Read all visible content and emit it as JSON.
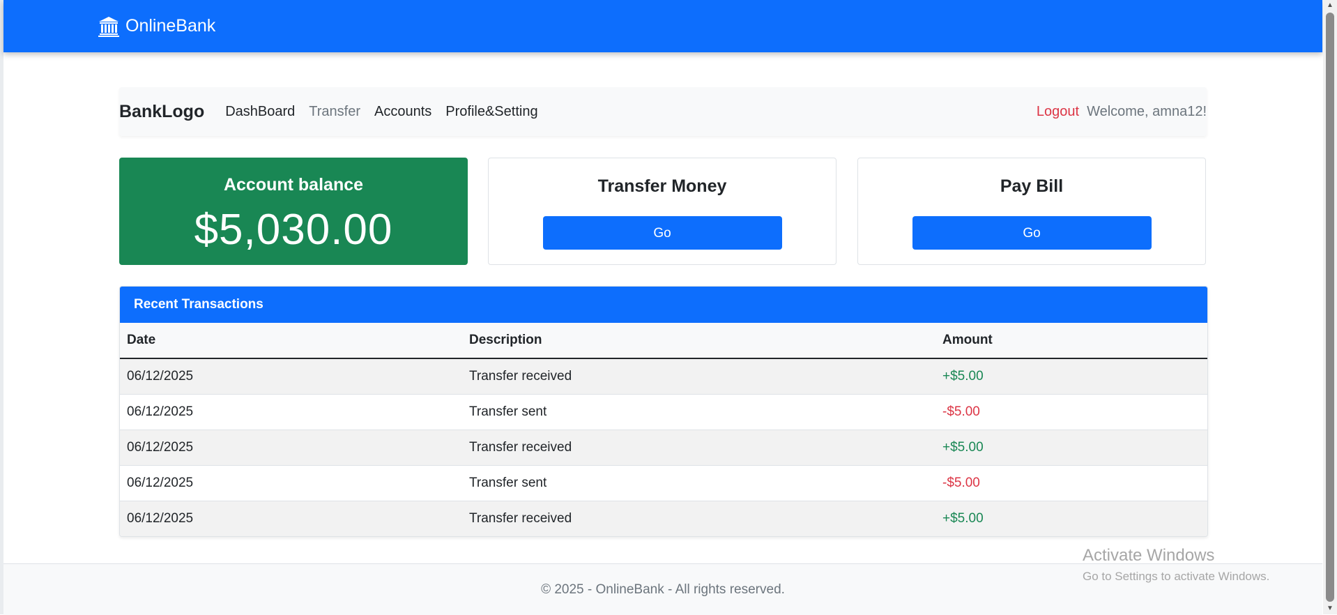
{
  "app": {
    "brand_name": "OnlineBank",
    "brand_icon": "bank-icon"
  },
  "nav": {
    "logo": "BankLogo",
    "links": [
      {
        "label": "DashBoard",
        "active": false
      },
      {
        "label": "Transfer",
        "active": true
      },
      {
        "label": "Accounts",
        "active": false
      },
      {
        "label": "Profile&Setting",
        "active": false
      }
    ],
    "logout_label": "Logout",
    "welcome_text": "Welcome, amna12!"
  },
  "cards": {
    "balance": {
      "title": "Account balance",
      "amount": "$5,030.00"
    },
    "transfer": {
      "title": "Transfer Money",
      "button": "Go"
    },
    "paybill": {
      "title": "Pay Bill",
      "button": "Go"
    }
  },
  "transactions": {
    "title": "Recent Transactions",
    "columns": [
      "Date",
      "Description",
      "Amount"
    ],
    "rows": [
      {
        "date": "06/12/2025",
        "description": "Transfer received",
        "amount": "+$5.00"
      },
      {
        "date": "06/12/2025",
        "description": "Transfer sent",
        "amount": "-$5.00"
      },
      {
        "date": "06/12/2025",
        "description": "Transfer received",
        "amount": "+$5.00"
      },
      {
        "date": "06/12/2025",
        "description": "Transfer sent",
        "amount": "-$5.00"
      },
      {
        "date": "06/12/2025",
        "description": "Transfer received",
        "amount": "+$5.00"
      }
    ]
  },
  "footer": {
    "text": "© 2025 - OnlineBank - All rights reserved."
  },
  "watermark": {
    "title": "Activate Windows",
    "subtitle": "Go to Settings to activate Windows."
  },
  "colors": {
    "primary": "#0d6efd",
    "success": "#198754",
    "danger": "#dc3545",
    "muted": "#6c757d"
  }
}
